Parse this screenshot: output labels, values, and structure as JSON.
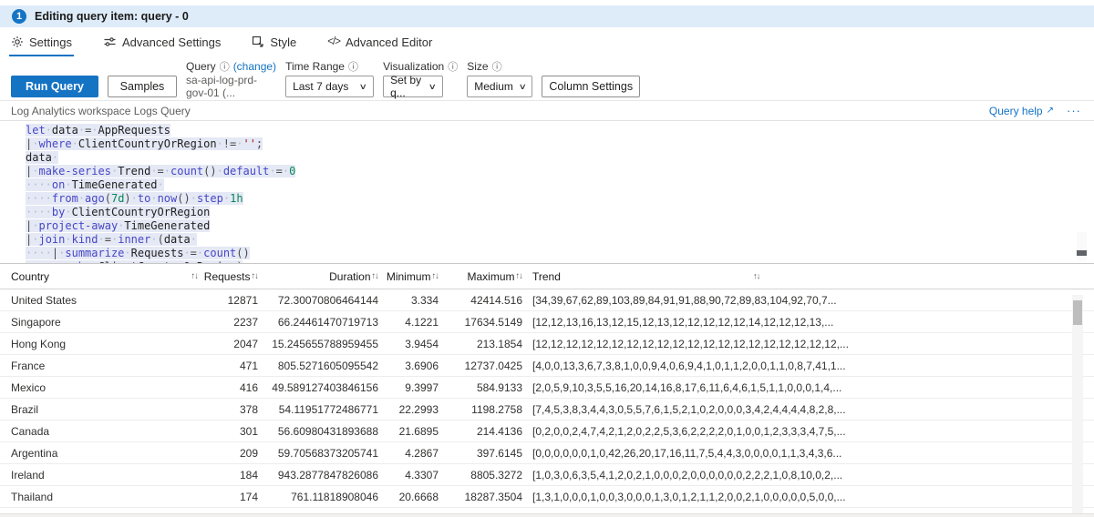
{
  "banner": {
    "step": "1",
    "title": "Editing query item: query - 0"
  },
  "tabs": [
    {
      "label": "Settings"
    },
    {
      "label": "Advanced Settings"
    },
    {
      "label": "Style"
    },
    {
      "label": "Advanced Editor"
    }
  ],
  "toolbar": {
    "run_button": "Run Query",
    "samples_button": "Samples",
    "query": {
      "label": "Query",
      "change_link": "(change)",
      "value": "sa-api-log-prd-gov-01 (..."
    },
    "time_range": {
      "label": "Time Range",
      "value": "Last 7 days"
    },
    "visualization": {
      "label": "Visualization",
      "value": "Set by q..."
    },
    "size": {
      "label": "Size",
      "value": "Medium"
    },
    "column_settings_button": "Column Settings"
  },
  "query_section": {
    "title": "Log Analytics workspace Logs Query",
    "help_link": "Query help",
    "more": "···"
  },
  "icons": {
    "info": "ⓘ",
    "chevron": "∨",
    "sort": "↑↓",
    "external": "↗",
    "code_tab": "</>"
  },
  "code": {
    "lines": [
      [
        [
          "k",
          "let"
        ],
        [
          "w",
          "·"
        ],
        [
          "i",
          "data"
        ],
        [
          "w",
          "·"
        ],
        [
          "o",
          "="
        ],
        [
          "w",
          "·"
        ],
        [
          "i",
          "AppRequests"
        ]
      ],
      [
        [
          "o",
          "|"
        ],
        [
          "w",
          "·"
        ],
        [
          "k",
          "where"
        ],
        [
          "w",
          "·"
        ],
        [
          "i",
          "ClientCountryOrRegion"
        ],
        [
          "w",
          "·"
        ],
        [
          "o",
          "!="
        ],
        [
          "w",
          "·"
        ],
        [
          "s",
          "''"
        ],
        [
          "o",
          ";"
        ]
      ],
      [
        [
          "i",
          "data"
        ],
        [
          "w",
          "·"
        ]
      ],
      [
        [
          "o",
          "|"
        ],
        [
          "w",
          "·"
        ],
        [
          "k",
          "make-series"
        ],
        [
          "w",
          "·"
        ],
        [
          "i",
          "Trend"
        ],
        [
          "w",
          "·"
        ],
        [
          "o",
          "="
        ],
        [
          "w",
          "·"
        ],
        [
          "f",
          "count"
        ],
        [
          "o",
          "()"
        ],
        [
          "w",
          "·"
        ],
        [
          "k",
          "default"
        ],
        [
          "w",
          "·"
        ],
        [
          "o",
          "="
        ],
        [
          "w",
          "·"
        ],
        [
          "n",
          "0"
        ]
      ],
      [
        [
          "w",
          "····"
        ],
        [
          "k",
          "on"
        ],
        [
          "w",
          "·"
        ],
        [
          "i",
          "TimeGenerated"
        ],
        [
          "w",
          "·"
        ]
      ],
      [
        [
          "w",
          "····"
        ],
        [
          "k",
          "from"
        ],
        [
          "w",
          "·"
        ],
        [
          "f",
          "ago"
        ],
        [
          "o",
          "("
        ],
        [
          "n",
          "7d"
        ],
        [
          "o",
          ")"
        ],
        [
          "w",
          "·"
        ],
        [
          "k",
          "to"
        ],
        [
          "w",
          "·"
        ],
        [
          "f",
          "now"
        ],
        [
          "o",
          "()"
        ],
        [
          "w",
          "·"
        ],
        [
          "k",
          "step"
        ],
        [
          "w",
          "·"
        ],
        [
          "n",
          "1h"
        ]
      ],
      [
        [
          "w",
          "····"
        ],
        [
          "k",
          "by"
        ],
        [
          "w",
          "·"
        ],
        [
          "i",
          "ClientCountryOrRegion"
        ]
      ],
      [
        [
          "o",
          "|"
        ],
        [
          "w",
          "·"
        ],
        [
          "k",
          "project-away"
        ],
        [
          "w",
          "·"
        ],
        [
          "i",
          "TimeGenerated"
        ]
      ],
      [
        [
          "o",
          "|"
        ],
        [
          "w",
          "·"
        ],
        [
          "k",
          "join"
        ],
        [
          "w",
          "·"
        ],
        [
          "k",
          "kind"
        ],
        [
          "w",
          "·"
        ],
        [
          "o",
          "="
        ],
        [
          "w",
          "·"
        ],
        [
          "k",
          "inner"
        ],
        [
          "w",
          "·"
        ],
        [
          "o",
          "("
        ],
        [
          "i",
          "data"
        ],
        [
          "w",
          "·"
        ]
      ],
      [
        [
          "w",
          "····"
        ],
        [
          "o",
          "|"
        ],
        [
          "w",
          "·"
        ],
        [
          "k",
          "summarize"
        ],
        [
          "w",
          "·"
        ],
        [
          "i",
          "Requests"
        ],
        [
          "w",
          "·"
        ],
        [
          "o",
          "="
        ],
        [
          "w",
          "·"
        ],
        [
          "f",
          "count"
        ],
        [
          "o",
          "()"
        ]
      ],
      [
        [
          "w",
          "········"
        ],
        [
          "k",
          "by"
        ],
        [
          "w",
          "·"
        ],
        [
          "i",
          "ClientCountryOrRegion"
        ],
        [
          "o",
          ")"
        ]
      ]
    ]
  },
  "table": {
    "columns": [
      {
        "label": "Country"
      },
      {
        "label": "Requests"
      },
      {
        "label": "Duration"
      },
      {
        "label": "Minimum"
      },
      {
        "label": "Maximum"
      },
      {
        "label": "Trend"
      }
    ],
    "rows": [
      {
        "country": "United States",
        "requests": "12871",
        "duration": "72.30070806464144",
        "minimum": "3.334",
        "maximum": "42414.516",
        "trend": "[34,39,67,62,89,103,89,84,91,91,88,90,72,89,83,104,92,70,7..."
      },
      {
        "country": "Singapore",
        "requests": "2237",
        "duration": "66.24461470719713",
        "minimum": "4.1221",
        "maximum": "17634.5149",
        "trend": "[12,12,13,16,13,12,15,12,13,12,12,12,12,12,14,12,12,12,13,..."
      },
      {
        "country": "Hong Kong",
        "requests": "2047",
        "duration": "15.245655788959455",
        "minimum": "3.9454",
        "maximum": "213.1854",
        "trend": "[12,12,12,12,12,12,12,12,12,12,12,12,12,12,12,12,12,12,12,12,..."
      },
      {
        "country": "France",
        "requests": "471",
        "duration": "805.5271605095542",
        "minimum": "3.6906",
        "maximum": "12737.0425",
        "trend": "[4,0,0,13,3,6,7,3,8,1,0,0,9,4,0,6,9,4,1,0,1,1,2,0,0,1,1,0,8,7,41,1..."
      },
      {
        "country": "Mexico",
        "requests": "416",
        "duration": "49.589127403846156",
        "minimum": "9.3997",
        "maximum": "584.9133",
        "trend": "[2,0,5,9,10,3,5,5,16,20,14,16,8,17,6,11,6,4,6,1,5,1,1,0,0,0,1,4,..."
      },
      {
        "country": "Brazil",
        "requests": "378",
        "duration": "54.11951772486771",
        "minimum": "22.2993",
        "maximum": "1198.2758",
        "trend": "[7,4,5,3,8,3,4,4,3,0,5,5,7,6,1,5,2,1,0,2,0,0,0,3,4,2,4,4,4,4,8,2,8,..."
      },
      {
        "country": "Canada",
        "requests": "301",
        "duration": "56.60980431893688",
        "minimum": "21.6895",
        "maximum": "214.4136",
        "trend": "[0,2,0,0,2,4,7,4,2,1,2,0,2,2,5,3,6,2,2,2,2,0,1,0,0,1,2,3,3,3,4,7,5,..."
      },
      {
        "country": "Argentina",
        "requests": "209",
        "duration": "59.70568373205741",
        "minimum": "4.2867",
        "maximum": "397.6145",
        "trend": "[0,0,0,0,0,0,1,0,42,26,20,17,16,11,7,5,4,4,3,0,0,0,0,1,1,3,4,3,6..."
      },
      {
        "country": "Ireland",
        "requests": "184",
        "duration": "943.2877847826086",
        "minimum": "4.3307",
        "maximum": "8805.3272",
        "trend": "[1,0,3,0,6,3,5,4,1,2,0,2,1,0,0,0,2,0,0,0,0,0,0,2,2,2,1,0,8,10,0,2,..."
      },
      {
        "country": "Thailand",
        "requests": "174",
        "duration": "761.11818908046",
        "minimum": "20.6668",
        "maximum": "18287.3504",
        "trend": "[1,3,1,0,0,0,1,0,0,3,0,0,0,1,3,0,1,2,1,1,2,0,0,2,1,0,0,0,0,0,5,0,0,..."
      }
    ]
  },
  "colors": {
    "accent": "#1373c4",
    "banner_bg": "#deecf9",
    "selection_bg": "#e5e9f5",
    "keyword": "#4646c6",
    "number": "#098658",
    "string": "#a31515"
  }
}
